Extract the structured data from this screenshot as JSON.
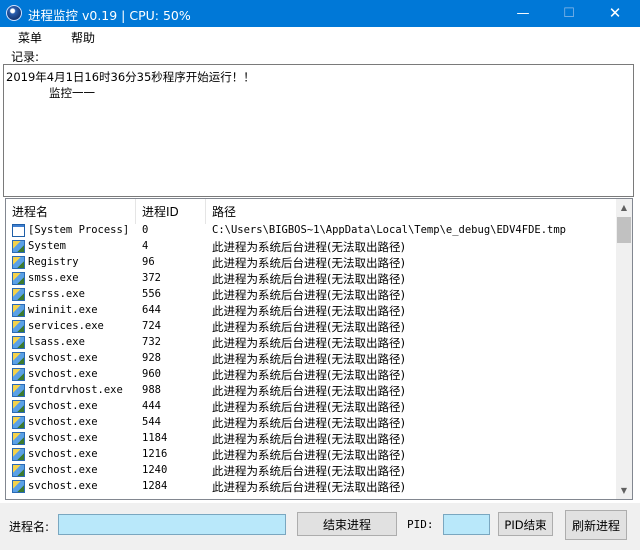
{
  "window": {
    "title": "进程监控 v0.19 | CPU: 50%",
    "minimize": "—",
    "maximize": "☐",
    "close": "✕"
  },
  "menu": {
    "items": [
      "菜单",
      "帮助"
    ]
  },
  "log": {
    "label": "记录:",
    "lines": [
      "2019年4月1日16时36分35秒程序开始运行！！",
      "监控一一"
    ]
  },
  "process_list": {
    "columns": [
      "进程名",
      "进程ID",
      "路径"
    ],
    "rows": [
      {
        "name": "[System Process]",
        "pid": "0",
        "path": "C:\\Users\\BIGBOS~1\\AppData\\Local\\Temp\\e_debug\\EDV4FDE.tmp",
        "icon": "system-process-icon"
      },
      {
        "name": "System",
        "pid": "4",
        "path": "此进程为系统后台进程(无法取出路径)",
        "icon": "process-icon"
      },
      {
        "name": "Registry",
        "pid": "96",
        "path": "此进程为系统后台进程(无法取出路径)",
        "icon": "process-icon"
      },
      {
        "name": "smss.exe",
        "pid": "372",
        "path": "此进程为系统后台进程(无法取出路径)",
        "icon": "process-icon"
      },
      {
        "name": "csrss.exe",
        "pid": "556",
        "path": "此进程为系统后台进程(无法取出路径)",
        "icon": "process-icon"
      },
      {
        "name": "wininit.exe",
        "pid": "644",
        "path": "此进程为系统后台进程(无法取出路径)",
        "icon": "process-icon"
      },
      {
        "name": "services.exe",
        "pid": "724",
        "path": "此进程为系统后台进程(无法取出路径)",
        "icon": "process-icon"
      },
      {
        "name": "lsass.exe",
        "pid": "732",
        "path": "此进程为系统后台进程(无法取出路径)",
        "icon": "process-icon"
      },
      {
        "name": "svchost.exe",
        "pid": "928",
        "path": "此进程为系统后台进程(无法取出路径)",
        "icon": "process-icon"
      },
      {
        "name": "svchost.exe",
        "pid": "960",
        "path": "此进程为系统后台进程(无法取出路径)",
        "icon": "process-icon"
      },
      {
        "name": "fontdrvhost.exe",
        "pid": "988",
        "path": "此进程为系统后台进程(无法取出路径)",
        "icon": "process-icon"
      },
      {
        "name": "svchost.exe",
        "pid": "444",
        "path": "此进程为系统后台进程(无法取出路径)",
        "icon": "process-icon"
      },
      {
        "name": "svchost.exe",
        "pid": "544",
        "path": "此进程为系统后台进程(无法取出路径)",
        "icon": "process-icon"
      },
      {
        "name": "svchost.exe",
        "pid": "1184",
        "path": "此进程为系统后台进程(无法取出路径)",
        "icon": "process-icon"
      },
      {
        "name": "svchost.exe",
        "pid": "1216",
        "path": "此进程为系统后台进程(无法取出路径)",
        "icon": "process-icon"
      },
      {
        "name": "svchost.exe",
        "pid": "1240",
        "path": "此进程为系统后台进程(无法取出路径)",
        "icon": "process-icon"
      },
      {
        "name": "svchost.exe",
        "pid": "1284",
        "path": "此进程为系统后台进程(无法取出路径)",
        "icon": "process-icon"
      }
    ]
  },
  "controls": {
    "name_label": "进程名:",
    "name_value": "",
    "end_button": "结束进程",
    "pid_label": "PID:",
    "pid_value": "",
    "pid_end_button": "PID结束",
    "refresh_button": "刷新进程"
  },
  "colors": {
    "titlebar": "#0078d7",
    "input_bg": "#b9e8fa"
  }
}
